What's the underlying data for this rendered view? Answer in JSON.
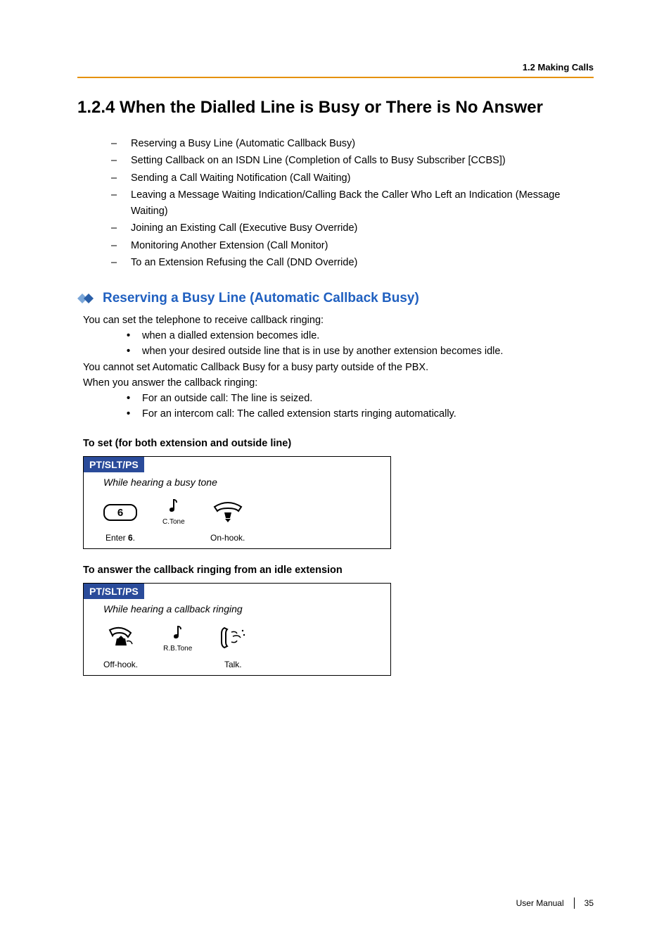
{
  "header": {
    "breadcrumb": "1.2 Making Calls"
  },
  "title": "1.2.4    When the Dialled Line is Busy or There is No Answer",
  "toc_items": [
    "Reserving a Busy Line (Automatic Callback Busy)",
    "Setting Callback on an ISDN Line (Completion of Calls to Busy Subscriber [CCBS])",
    "Sending a Call Waiting Notification (Call Waiting)",
    "Leaving a Message Waiting Indication/Calling Back the Caller Who Left an Indication (Message Waiting)",
    "Joining an Existing Call (Executive Busy Override)",
    "Monitoring Another Extension (Call Monitor)",
    "To an Extension Refusing the Call (DND Override)"
  ],
  "section": {
    "heading": "Reserving a Busy Line (Automatic Callback Busy)",
    "intro": "You can set the telephone to receive callback ringing:",
    "bullets1": [
      "when a dialled extension becomes idle.",
      "when your desired outside line that is in use by another extension becomes idle."
    ],
    "p2": "You cannot set Automatic Callback Busy for a busy party outside of the PBX.",
    "p3": "When you answer the callback ringing:",
    "bullets2": [
      "For an outside call: The line is seized.",
      "For an intercom call: The called extension starts ringing automatically."
    ]
  },
  "proc1": {
    "heading": "To set (for both extension and outside line)",
    "box_header": "PT/SLT/PS",
    "condition": "While hearing a busy tone",
    "key": "6",
    "tone_label": "C.Tone",
    "step1_caption_pre": "Enter ",
    "step1_caption_bold": "6",
    "step1_caption_post": ".",
    "step2_caption": "On-hook."
  },
  "proc2": {
    "heading": "To answer the callback ringing from an idle extension",
    "box_header": "PT/SLT/PS",
    "condition": "While hearing a callback ringing",
    "tone_label": "R.B.Tone",
    "step1_caption": "Off-hook.",
    "step2_caption": "Talk."
  },
  "footer": {
    "label": "User Manual",
    "page": "35"
  }
}
